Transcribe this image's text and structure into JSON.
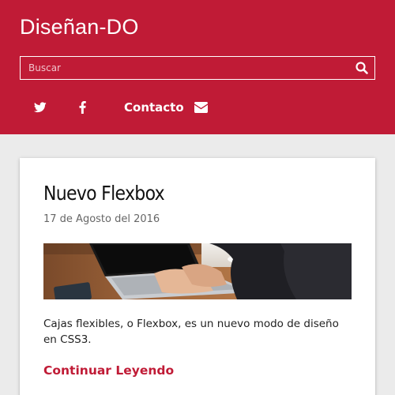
{
  "header": {
    "site_title": "Diseñan-DO",
    "search": {
      "placeholder": "Buscar",
      "value": ""
    },
    "nav": {
      "twitter_icon": "twitter-icon",
      "facebook_icon": "facebook-icon",
      "contact_label": "Contacto",
      "contact_icon": "envelope-icon"
    }
  },
  "post": {
    "title": "Nuevo Flexbox",
    "date": "17 de Agosto del 2016",
    "excerpt": "Cajas flexibles, o Flexbox, es un nuevo modo de diseño en CSS3.",
    "read_more_label": "Continuar Leyendo"
  },
  "colors": {
    "brand": "#c01b36",
    "background": "#ebebeb",
    "card": "#ffffff"
  }
}
